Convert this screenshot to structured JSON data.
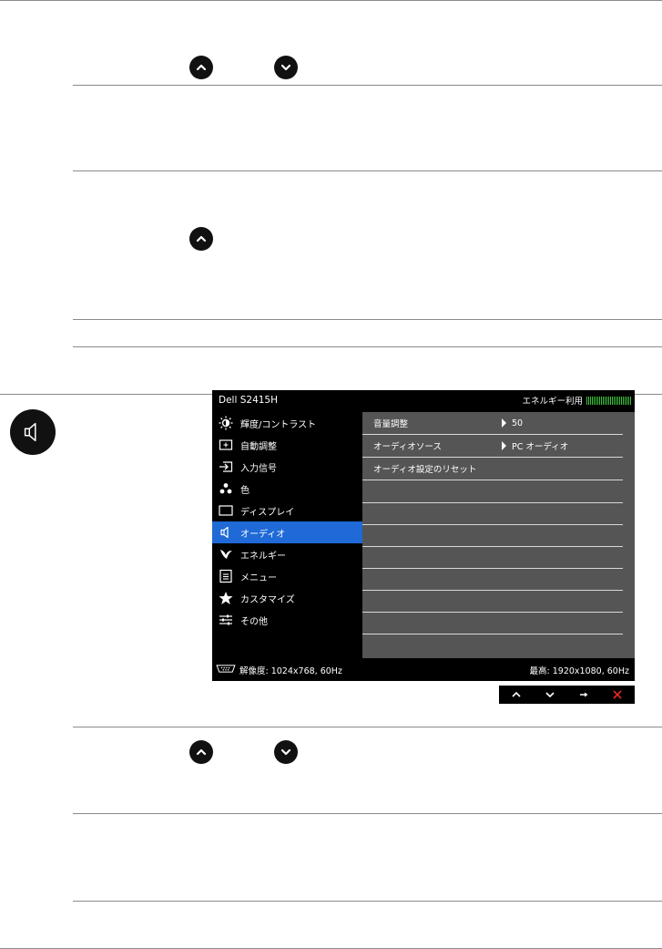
{
  "osd": {
    "title": "Dell S2415H",
    "energy_label": "エネルギー利用",
    "menu": [
      {
        "label": "輝度/コントラスト",
        "icon": "brightness-icon"
      },
      {
        "label": "自動調整",
        "icon": "auto-adjust-icon"
      },
      {
        "label": "入力信号",
        "icon": "input-source-icon"
      },
      {
        "label": "色",
        "icon": "color-icon"
      },
      {
        "label": "ディスプレイ",
        "icon": "display-icon"
      },
      {
        "label": "オーディオ",
        "icon": "speaker-icon"
      },
      {
        "label": "エネルギー",
        "icon": "energy-leaf-icon"
      },
      {
        "label": "メニュー",
        "icon": "menu-icon"
      },
      {
        "label": "カスタマイズ",
        "icon": "star-icon"
      },
      {
        "label": "その他",
        "icon": "others-sliders-icon"
      }
    ],
    "selected_menu": "オーディオ",
    "rows": [
      {
        "label": "音量調整",
        "value": "50"
      },
      {
        "label": "オーディオソース",
        "value": "PC オーディオ"
      },
      {
        "label": "オーディオ設定のリセット",
        "value": ""
      }
    ],
    "resolution": "解像度: 1024x768, 60Hz",
    "max_resolution": "最高: 1920x1080, 60Hz"
  },
  "colors": {
    "osd_bg": "#000000",
    "osd_panel": "#555555",
    "selected": "#1f6ad6",
    "energy_green": "#3fc33f",
    "close_red": "#e0261e"
  },
  "icons": {
    "up": "chevron-up-icon",
    "down": "chevron-down-icon",
    "enter": "arrow-right-icon",
    "exit": "close-x-icon",
    "section": "speaker-icon"
  }
}
